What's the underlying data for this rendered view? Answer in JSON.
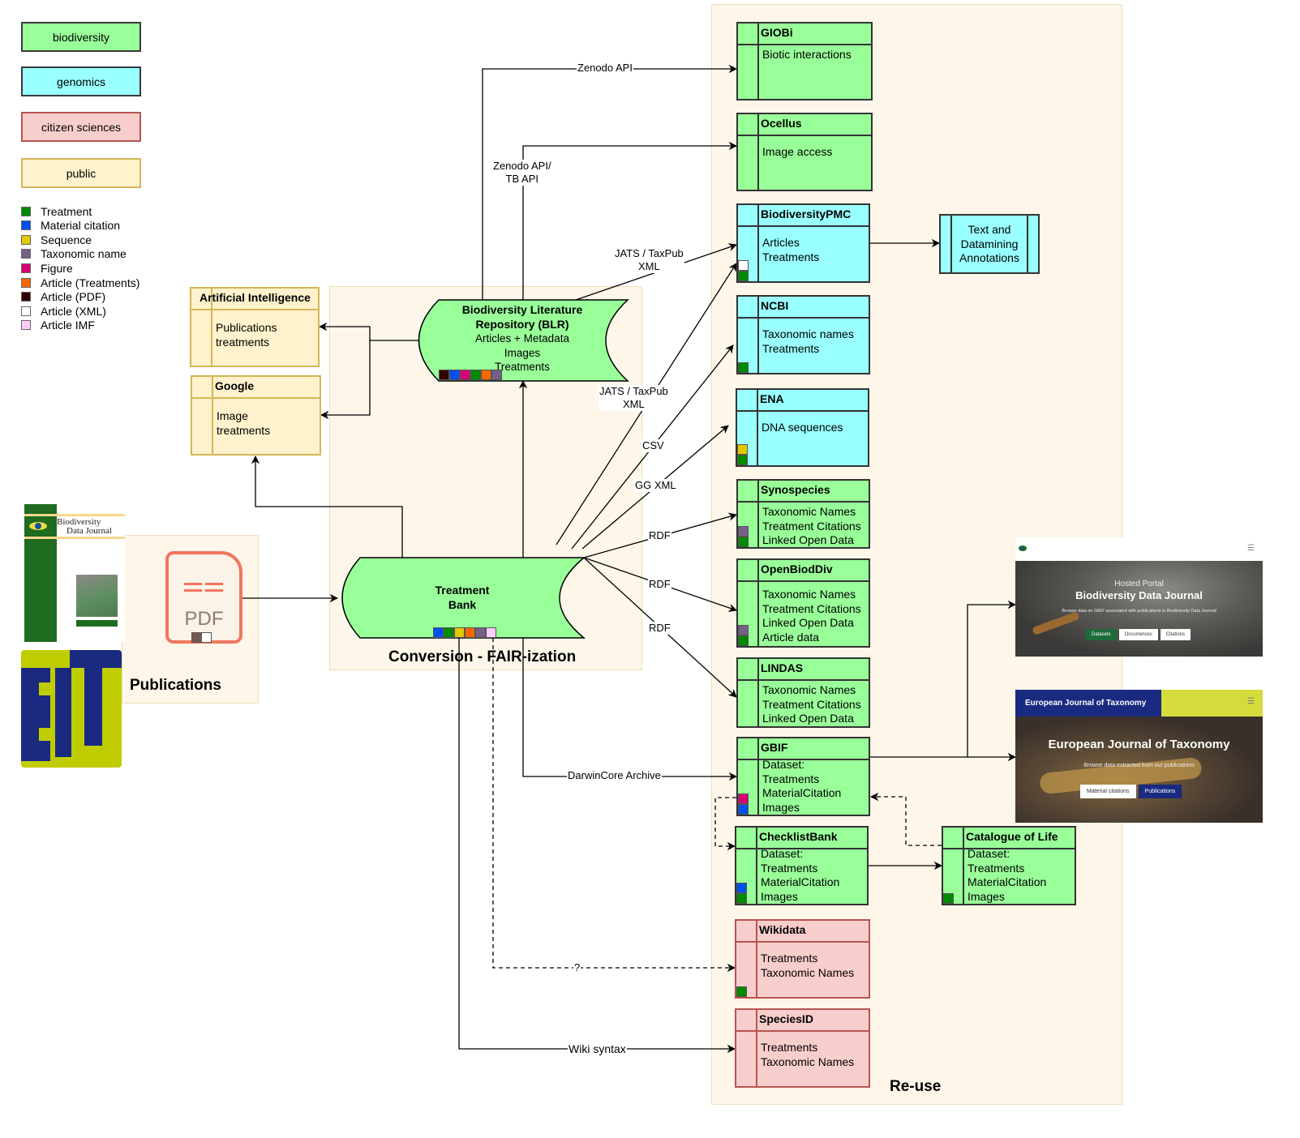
{
  "legend": {
    "categories": [
      {
        "label": "biodiversity",
        "color": "#99ff99"
      },
      {
        "label": "genomics",
        "color": "#99ffff"
      },
      {
        "label": "citizen sciences",
        "color": "#f8cecc"
      },
      {
        "label": "public",
        "color": "#fff2cc"
      }
    ],
    "data_types": [
      {
        "label": "Treatment",
        "color": "#008a00"
      },
      {
        "label": "Material citation",
        "color": "#0050ef"
      },
      {
        "label": "Sequence",
        "color": "#e3c800"
      },
      {
        "label": "Taxonomic name",
        "color": "#76608a"
      },
      {
        "label": "Figure",
        "color": "#d80073"
      },
      {
        "label": "Article (Treatments)",
        "color": "#fa6800"
      },
      {
        "label": "Article (PDF)",
        "color": "#330000"
      },
      {
        "label": "Article (XML)",
        "color": "#ffffff"
      },
      {
        "label": "Article IMF",
        "color": "#ffccff"
      }
    ]
  },
  "regions": {
    "publications": "Publications",
    "conversion": "Conversion - FAIR-ization",
    "reuse": "Re-use"
  },
  "publications": {
    "pdf_icon_label": "PDF",
    "bdj_cover": {
      "title_line1": "Biodiversity",
      "title_line2": "Data Journal"
    },
    "ejt_logo": "EJT"
  },
  "blr": {
    "title": "Biodiversity Literature\nRepository (BLR)",
    "body": "Articles + Metadata\nImages\nTreatments"
  },
  "treatment_bank": {
    "title": "Treatment\nBank"
  },
  "public_services": [
    {
      "name": "Artificial Intelligence",
      "body": "Publications\ntreatments"
    },
    {
      "name": "Google",
      "body": "Image\ntreatments"
    }
  ],
  "services": [
    {
      "name": "GIOBi",
      "body": "Biotic interactions"
    },
    {
      "name": "Ocellus",
      "body": "Image access"
    },
    {
      "name": "BiodiversityPMC",
      "body": "Articles\nTreatments"
    },
    {
      "name": "NCBI",
      "body": "Taxonomic names\nTreatments"
    },
    {
      "name": "ENA",
      "body": "DNA sequences"
    },
    {
      "name": "Synospecies",
      "body": "Taxonomic Names\nTreatment Citations\nLinked Open Data"
    },
    {
      "name": "OpenBiodDiv",
      "body": "Taxonomic Names\nTreatment Citations\nLinked Open Data\nArticle data"
    },
    {
      "name": "LINDAS",
      "body": "Taxonomic Names\nTreatment Citations\nLinked Open Data"
    },
    {
      "name": "GBIF",
      "body": "Dataset:\nTreatments\nMaterialCitation\nImages"
    },
    {
      "name": "ChecklistBank",
      "body": "Dataset:\nTreatments\nMaterialCitation\nImages"
    },
    {
      "name": "Catalogue of Life",
      "body": "Dataset:\nTreatments\nMaterialCitation\nImages"
    },
    {
      "name": "Wikidata",
      "body": "Treatments\nTaxonomic Names"
    },
    {
      "name": "SpeciesID",
      "body": "Treatments\nTaxonomic Names"
    }
  ],
  "tdm": {
    "body": "Text and\nDatamining\nAnnotations"
  },
  "edge_labels": {
    "zenodo_api": "Zenodo API",
    "zenodo_tb_api": "Zenodo API/\nTB API",
    "jats_blr": "JATS / TaxPub\nXML",
    "jats_tb": "JATS / TaxPub\nXML",
    "csv": "CSV",
    "gg_xml": "GG XML",
    "rdf1": "RDF",
    "rdf2": "RDF",
    "rdf3": "RDF",
    "dwca": "DarwinCore Archive",
    "question": "?",
    "wiki": "Wiki syntax"
  },
  "portals": {
    "bdj": {
      "subtitle": "Hosted Portal",
      "title": "Biodiversity Data Journal",
      "tagline": "Browse data on GBIF associated with publications in Biodiversity Data Journal",
      "buttons": [
        "Datasets",
        "Occurrences",
        "Citations"
      ]
    },
    "ejt": {
      "nav_title": "European Journal of Taxonomy",
      "title": "European Journal of Taxonomy",
      "tagline": "Browse data extracted from our publications",
      "buttons": [
        "Material citations",
        "Publications"
      ]
    }
  }
}
